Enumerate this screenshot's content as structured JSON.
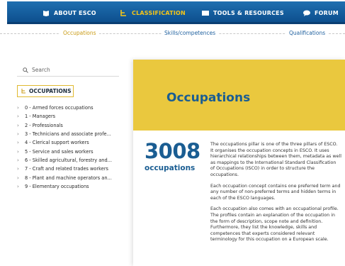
{
  "nav": {
    "items": [
      {
        "label": "ABOUT ESCO",
        "icon": "book-icon"
      },
      {
        "label": "CLASSIFICATION",
        "icon": "hierarchy-icon"
      },
      {
        "label": "TOOLS & RESOURCES",
        "icon": "folder-icon"
      },
      {
        "label": "FORUM",
        "icon": "chat-icon"
      }
    ],
    "active": "CLASSIFICATION",
    "colors": {
      "bar": "#0d4f8e",
      "active": "#f5c518"
    }
  },
  "tabs": [
    {
      "label": "Occupations",
      "active": true
    },
    {
      "label": "Skills/competences",
      "active": false
    },
    {
      "label": "Qualifications",
      "active": false
    }
  ],
  "sidebar": {
    "search_placeholder": "Search",
    "section_title": "OCCUPATIONS",
    "items": [
      "0 - Armed forces occupations",
      "1 - Managers",
      "2 - Professionals",
      "3 - Technicians and associate profe...",
      "4 - Clerical support workers",
      "5 - Service and sales workers",
      "6 - Skilled agricultural, forestry and...",
      "7 - Craft and related trades workers",
      "8 - Plant and machine operators an...",
      "9 - Elementary occupations"
    ]
  },
  "main": {
    "title": "Occupations",
    "count": "3008",
    "count_label": "occupations",
    "paragraphs": [
      "The occupations pillar is one of the three pillars of ESCO. It organises the occupation concepts in ESCO. It uses hierarchical relationships between them, metadata as well as mappings to the International Standard Classification of Occupations (ISCO) in order to structure the occupations.",
      "Each occupation concept contains one preferred term and any number of non-preferred terms and hidden terms in each of the ESCO languages.",
      "Each occupation also comes with an occupational profile. The profiles contain an explanation of the occupation in the form of description, scope note and definition. Furthermore, they list the knowledge, skills and competences that experts considered relevant terminology for this occupation on a European scale."
    ],
    "colors": {
      "hero": "#eac83e",
      "title": "#1a5d92"
    }
  }
}
